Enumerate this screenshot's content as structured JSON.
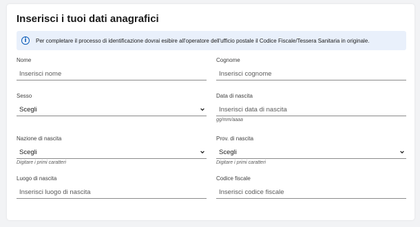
{
  "form": {
    "title": "Inserisci i tuoi dati anagrafici",
    "info_text": "Per completare il processo di identificazione dovrai esibire all'operatore dell'ufficio postale il Codice Fiscale/Tessera Sanitaria in originale.",
    "info_icon": "info-icon"
  },
  "fields": {
    "nome": {
      "label": "Nome",
      "placeholder": "Inserisci nome"
    },
    "cognome": {
      "label": "Cognome",
      "placeholder": "Inserisci cognome"
    },
    "sesso": {
      "label": "Sesso",
      "selected": "Scegli"
    },
    "data_nascita": {
      "label": "Data di nascita",
      "placeholder": "Inserisci data di nascita",
      "hint": "gg/mm/aaaa"
    },
    "nazione_nascita": {
      "label": "Nazione di nascita",
      "selected": "Scegli",
      "hint": "Digitare i primi caratteri"
    },
    "prov_nascita": {
      "label": "Prov. di nascita",
      "selected": "Scegli",
      "hint": "Digitare i primi caratteri"
    },
    "luogo_nascita": {
      "label": "Luogo di nascita",
      "placeholder": "Inserisci luogo di nascita"
    },
    "codice_fiscale": {
      "label": "Codice fiscale",
      "placeholder": "Inserisci codice fiscale"
    }
  }
}
